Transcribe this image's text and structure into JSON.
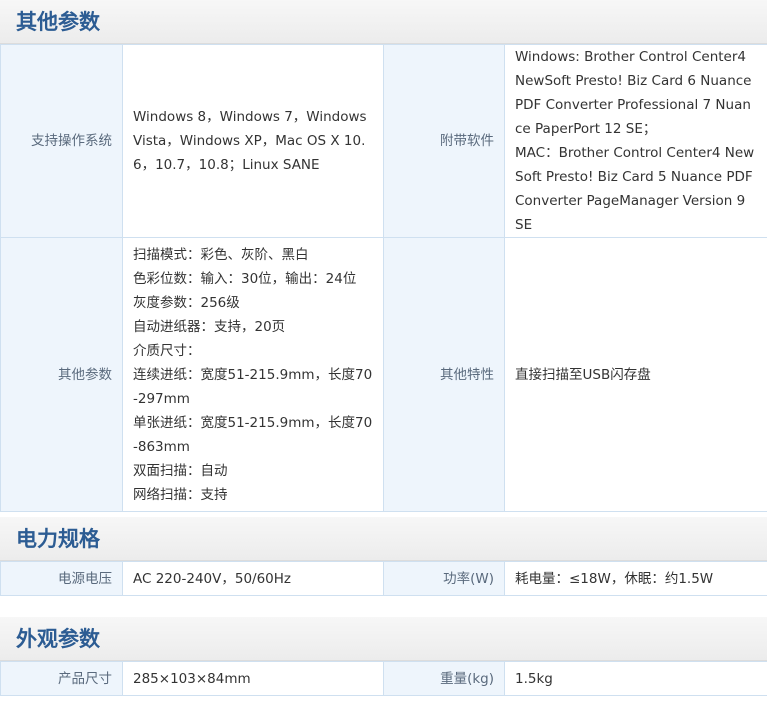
{
  "sections": [
    {
      "title": "其他参数",
      "rows": [
        {
          "label1": "支持操作系统",
          "value1": [
            "Windows 8，Windows 7，Windows Vista，Windows XP，Mac OS X 10.6，10.7，10.8；Linux SANE"
          ],
          "label2": "附带软件",
          "value2": [
            "Windows: Brother Control Center4 NewSoft Presto! Biz Card 6 Nuance PDF Converter Professional 7 Nuance PaperPort 12 SE；",
            "MAC：Brother Control Center4 NewSoft Presto! Biz Card 5 Nuance PDF Converter PageManager Version 9 SE"
          ]
        },
        {
          "label1": "其他参数",
          "value1": [
            "扫描模式：彩色、灰阶、黑白",
            "色彩位数：输入：30位，输出：24位",
            "灰度参数：256级",
            "自动进纸器：支持，20页",
            "介质尺寸：",
            "连续进纸：宽度51-215.9mm，长度70-297mm",
            "单张进纸：宽度51-215.9mm，长度70-863mm",
            "双面扫描：自动",
            "网络扫描：支持"
          ],
          "label2": "其他特性",
          "value2": [
            "直接扫描至USB闪存盘"
          ]
        }
      ]
    },
    {
      "title": "电力规格",
      "rows": [
        {
          "label1": "电源电压",
          "value1": [
            "AC 220-240V，50/60Hz"
          ],
          "label2": "功率(W)",
          "value2": [
            "耗电量：≤18W，休眠：约1.5W"
          ]
        }
      ]
    },
    {
      "title": "外观参数",
      "rows": [
        {
          "label1": "产品尺寸",
          "value1": [
            "285×103×84mm"
          ],
          "label2": "重量(kg)",
          "value2": [
            "1.5kg"
          ]
        }
      ]
    }
  ]
}
